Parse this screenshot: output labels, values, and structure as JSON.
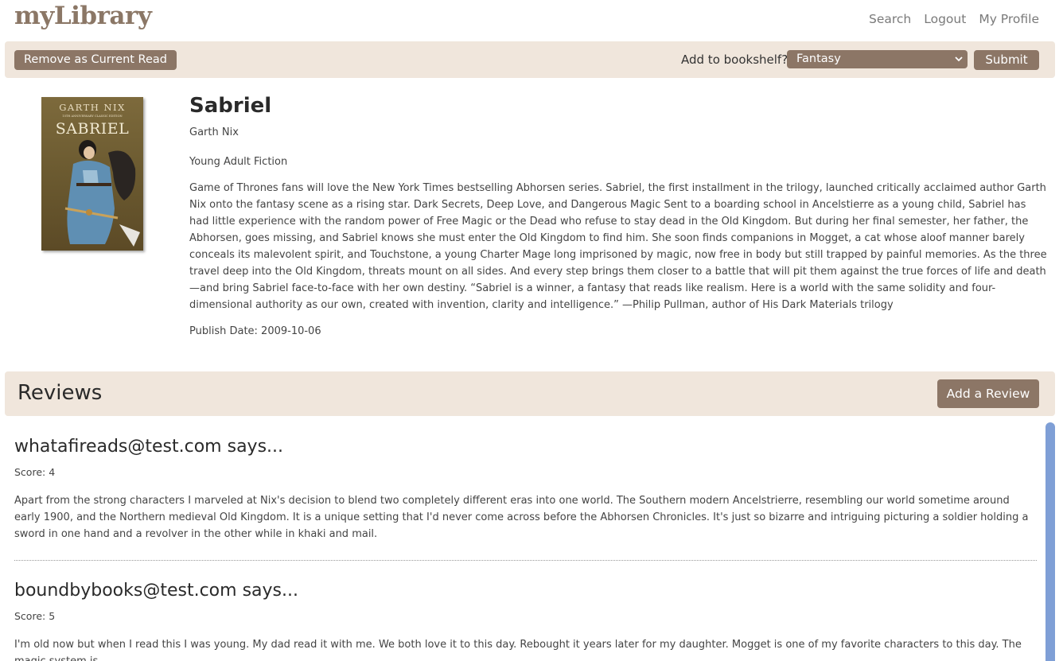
{
  "app": {
    "logo": "myLibrary"
  },
  "nav": {
    "links": [
      "Search",
      "Logout",
      "My Profile"
    ]
  },
  "actionbar": {
    "remove_label": "Remove as Current Read",
    "shelf_label": "Add to bookshelf?",
    "shelf_selected": "Fantasy",
    "submit_label": "Submit"
  },
  "book": {
    "cover_text_author": "GARTH NIX",
    "cover_text_edition": "15TH ANNIVERSARY CLASSIC EDITION",
    "cover_text_title": "SABRIEL",
    "title": "Sabriel",
    "author": "Garth Nix",
    "genre": "Young Adult Fiction",
    "description": "Game of Thrones fans will love the New York Times bestselling Abhorsen series. Sabriel, the first installment in the trilogy, launched critically acclaimed author Garth Nix onto the fantasy scene as a rising star. Dark Secrets, Deep Love, and Dangerous Magic Sent to a boarding school in Ancelstierre as a young child, Sabriel has had little experience with the random power of Free Magic or the Dead who refuse to stay dead in the Old Kingdom. But during her final semester, her father, the Abhorsen, goes missing, and Sabriel knows she must enter the Old Kingdom to find him. She soon finds companions in Mogget, a cat whose aloof manner barely conceals its malevolent spirit, and Touchstone, a young Charter Mage long imprisoned by magic, now free in body but still trapped by painful memories. As the three travel deep into the Old Kingdom, threats mount on all sides. And every step brings them closer to a battle that will pit them against the true forces of life and death—and bring Sabriel face-to-face with her own destiny. “Sabriel is a winner, a fantasy that reads like realism. Here is a world with the same solidity and four-dimensional authority as our own, created with invention, clarity and intelligence.” —Philip Pullman, author of His Dark Materials trilogy",
    "publish_date": "Publish Date: 2009-10-06"
  },
  "reviews": {
    "title": "Reviews",
    "add_label": "Add a Review",
    "items": [
      {
        "author": "whatafireads@test.com says...",
        "score": "Score: 4",
        "text": "Apart from the strong characters I marveled at Nix's decision to blend two completely different eras into one world. The Southern modern Ancelstrierre, resembling our world sometime around early 1900, and the Northern medieval Old Kingdom. It is a unique setting that I'd never come across before the Abhorsen Chronicles. It's just so bizarre and intriguing picturing a soldier holding a sword in one hand and a revolver in the other while in khaki and mail."
      },
      {
        "author": "boundbybooks@test.com says...",
        "score": "Score: 5",
        "text": "I'm old now but when I read this I was young. My dad read it with me. We both love it to this day. Rebought it years later for my daughter. Mogget is one of my favorite characters to this day. The magic system is"
      }
    ]
  },
  "icons": {
    "select_chevron": "chevron-down-icon"
  },
  "colors": {
    "brand": "#8b7766",
    "button": "#8c7666",
    "bar_background": "#f0e6dc",
    "scrollbar": "#7f9fd6"
  }
}
